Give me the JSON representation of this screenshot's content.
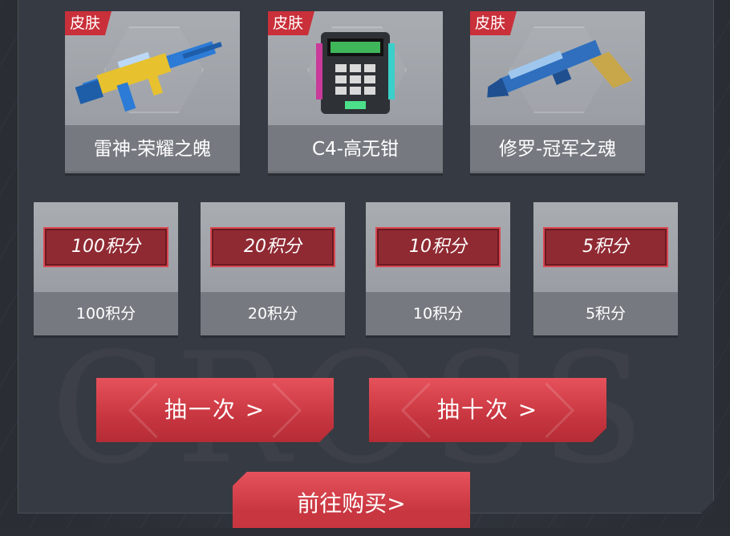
{
  "prizes": [
    {
      "tag": "皮肤",
      "name": "雷神-荣耀之魄",
      "icon": "rifle-icon"
    },
    {
      "tag": "皮肤",
      "name": "C4-高无钳",
      "icon": "c4-bomb-icon"
    },
    {
      "tag": "皮肤",
      "name": "修罗-冠军之魂",
      "icon": "pistol-icon"
    }
  ],
  "points": [
    {
      "badge": "100积分",
      "label": "100积分"
    },
    {
      "badge": "20积分",
      "label": "20积分"
    },
    {
      "badge": "10积分",
      "label": "10积分"
    },
    {
      "badge": "5积分",
      "label": "5积分"
    }
  ],
  "actions": {
    "draw_once": "抽一次 >",
    "draw_ten": "抽十次 >",
    "buy": "前往购买>"
  },
  "colors": {
    "accent_red": "#c83640",
    "panel": "#363a42",
    "card": "#8c9096"
  }
}
